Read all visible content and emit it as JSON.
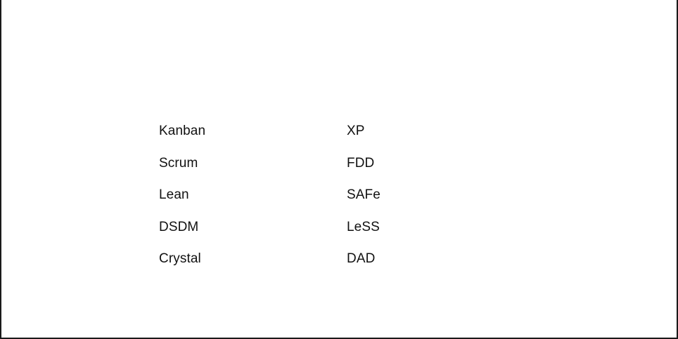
{
  "lists": {
    "left": [
      "Kanban",
      "Scrum",
      "Lean",
      "DSDM",
      "Crystal"
    ],
    "right": [
      "XP",
      "FDD",
      "SAFe",
      "LeSS",
      "DAD"
    ]
  }
}
